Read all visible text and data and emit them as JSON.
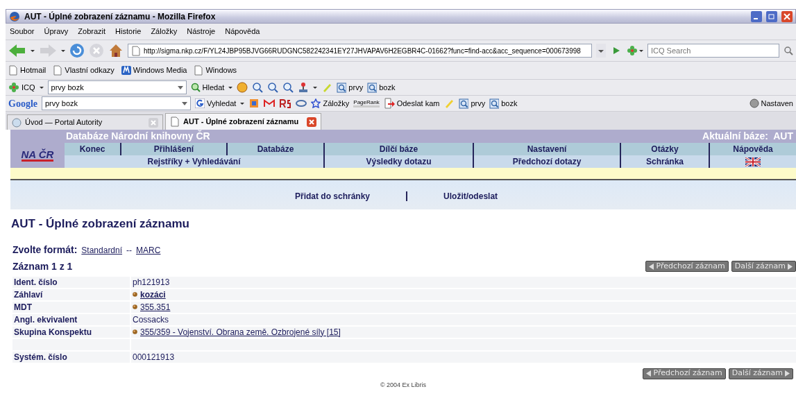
{
  "window": {
    "title": "AUT - Úplné zobrazení záznamu - Mozilla Firefox"
  },
  "menu": [
    "Soubor",
    "Úpravy",
    "Zobrazit",
    "Historie",
    "Záložky",
    "Nástroje",
    "Nápověda"
  ],
  "navigation_toolbar": {
    "url": "http://sigma.nkp.cz/F/YL24JBP95BJVG66RUDGNC582242341EY27JHVAPAV6H2EGBR4C-01662?func=find-acc&acc_sequence=000673998",
    "search": {
      "placeholder": "ICQ Search"
    }
  },
  "bookmarks": [
    {
      "label": "Hotmail",
      "kind": "page"
    },
    {
      "label": "Vlastní odkazy",
      "kind": "page"
    },
    {
      "label": "Windows Media",
      "kind": "media"
    },
    {
      "label": "Windows",
      "kind": "page"
    }
  ],
  "icq_toolbar": {
    "label": "ICQ",
    "search_value": "prvy bozk",
    "search_button": "Hledat",
    "buttons": [
      "prvy",
      "bozk"
    ]
  },
  "google_toolbar": {
    "logo": "Google",
    "search_value": "prvy bozk",
    "search_button": "Vyhledat",
    "bookmarks_button": "Záložky",
    "pagerank": "PageRank",
    "send_button": "Odeslat kam",
    "buttons": [
      "prvy",
      "bozk"
    ],
    "settings_button": "Nastaven"
  },
  "tabs": [
    {
      "label": "Úvod — Portal Autority",
      "selected": false
    },
    {
      "label": "AUT - Úplné zobrazení záznamu",
      "selected": true
    }
  ],
  "page": {
    "logo": "NA ČR",
    "site_title": "Databáze Národní knihovny ČR",
    "current_base": "Aktuální báze:  AUT",
    "nav_primary": [
      "Konec",
      "Přihlášení",
      "Databáze",
      "Dílčí báze",
      "Nastavení",
      "Otázky",
      "Nápověda"
    ],
    "nav_secondary": [
      "Rejstříky + Vyhledávání",
      "Výsledky dotazu",
      "Předchozí dotazy",
      "Schránka"
    ],
    "actions": [
      "Přidat do schránky",
      "Uložit/odeslat"
    ],
    "heading": "AUT - Úplné zobrazení záznamu",
    "format": {
      "label": "Zvolte formát:",
      "options": [
        "Standardní",
        "MARC"
      ],
      "separator": "--"
    },
    "record_count": "Záznam 1 z 1",
    "pager_top": {
      "previous": "Předchozí záznam",
      "next": "Další záznam"
    },
    "fields": [
      {
        "kind": "text",
        "label": "Ident. číslo",
        "value": "ph121913"
      },
      {
        "kind": "link",
        "label": "Záhlaví",
        "value": "kozáci",
        "bold": true
      },
      {
        "kind": "link",
        "label": "MDT",
        "value": "355.351",
        "bold": false
      },
      {
        "kind": "text",
        "label": "Angl. ekvivalent",
        "value": "Cossacks"
      },
      {
        "kind": "link",
        "label": "Skupina Konspektu",
        "value": "355/359 - Vojenství. Obrana země. Ozbrojené síly [15]",
        "bold": false
      },
      {
        "kind": "blank"
      },
      {
        "kind": "text",
        "label": "Systém. číslo",
        "value": "000121913"
      }
    ],
    "pager_bottom": {
      "previous": "Předchozí záznam",
      "next": "Další záznam"
    },
    "footer": "© 2004 Ex Libris"
  }
}
